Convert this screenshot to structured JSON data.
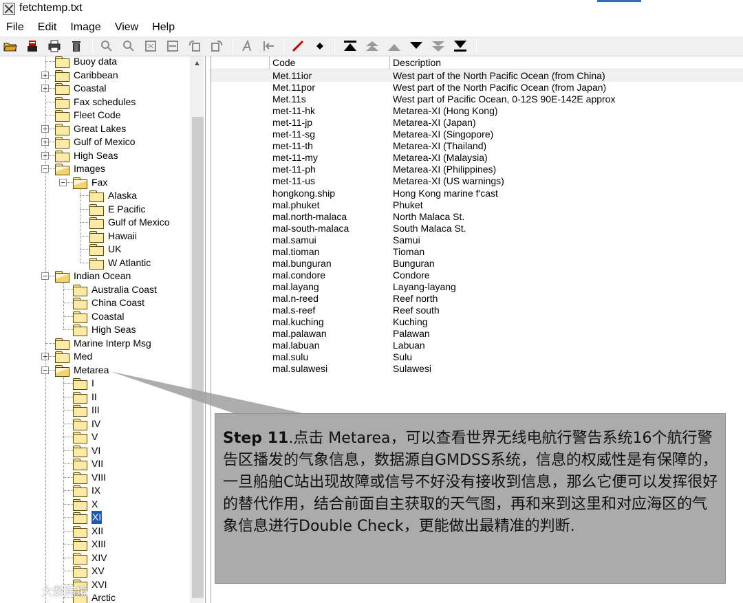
{
  "window": {
    "title": "fetchtemp.txt"
  },
  "menu": [
    "File",
    "Edit",
    "Image",
    "View",
    "Help"
  ],
  "toolbar": {
    "icons": [
      "open-folder-icon",
      "save-icon",
      "print-icon",
      "delete-icon",
      "zoom-in-icon",
      "zoom-out-icon",
      "fit-icon",
      "fit-width-icon",
      "rotate-left-icon",
      "rotate-right-icon",
      "text-icon",
      "back-icon",
      "line-icon",
      "point-icon",
      "top-icon",
      "up-fast-icon",
      "up-icon",
      "down-icon",
      "down-fast-icon",
      "bottom-icon"
    ],
    "colors": {
      "red": "#c00000",
      "black": "#000000",
      "gray": "#8a8a8a"
    }
  },
  "tree": {
    "items": [
      {
        "label": "Buoy data",
        "level": 1,
        "expander": "",
        "open": false
      },
      {
        "label": "Caribbean",
        "level": 1,
        "expander": "+",
        "open": false
      },
      {
        "label": "Coastal",
        "level": 1,
        "expander": "+",
        "open": false
      },
      {
        "label": "Fax schedules",
        "level": 1,
        "expander": "",
        "open": false
      },
      {
        "label": "Fleet Code",
        "level": 1,
        "expander": "",
        "open": false
      },
      {
        "label": "Great Lakes",
        "level": 1,
        "expander": "+",
        "open": false
      },
      {
        "label": "Gulf of Mexico",
        "level": 1,
        "expander": "+",
        "open": false
      },
      {
        "label": "High Seas",
        "level": 1,
        "expander": "+",
        "open": false
      },
      {
        "label": "Images",
        "level": 1,
        "expander": "-",
        "open": true
      },
      {
        "label": "Fax",
        "level": 2,
        "expander": "-",
        "open": true
      },
      {
        "label": "Alaska",
        "level": 3,
        "expander": "",
        "open": false
      },
      {
        "label": "E Pacific",
        "level": 3,
        "expander": "",
        "open": false
      },
      {
        "label": "Gulf of Mexico",
        "level": 3,
        "expander": "",
        "open": false
      },
      {
        "label": "Hawaii",
        "level": 3,
        "expander": "",
        "open": false
      },
      {
        "label": "UK",
        "level": 3,
        "expander": "",
        "open": false
      },
      {
        "label": "W Atlantic",
        "level": 3,
        "expander": "",
        "open": false
      },
      {
        "label": "Indian Ocean",
        "level": 1,
        "expander": "-",
        "open": true
      },
      {
        "label": "Australia Coast",
        "level": 2,
        "expander": "",
        "open": false
      },
      {
        "label": "China Coast",
        "level": 2,
        "expander": "",
        "open": false
      },
      {
        "label": "Coastal",
        "level": 2,
        "expander": "",
        "open": false
      },
      {
        "label": "High Seas",
        "level": 2,
        "expander": "",
        "open": false
      },
      {
        "label": "Marine Interp Msg",
        "level": 1,
        "expander": "",
        "open": false
      },
      {
        "label": "Med",
        "level": 1,
        "expander": "+",
        "open": false
      },
      {
        "label": "Metarea",
        "level": 1,
        "expander": "-",
        "open": true
      },
      {
        "label": "I",
        "level": 2,
        "expander": "",
        "open": false
      },
      {
        "label": "II",
        "level": 2,
        "expander": "",
        "open": false
      },
      {
        "label": "III",
        "level": 2,
        "expander": "",
        "open": false
      },
      {
        "label": "IV",
        "level": 2,
        "expander": "",
        "open": false
      },
      {
        "label": "V",
        "level": 2,
        "expander": "",
        "open": false
      },
      {
        "label": "VI",
        "level": 2,
        "expander": "",
        "open": false
      },
      {
        "label": "VII",
        "level": 2,
        "expander": "",
        "open": false
      },
      {
        "label": "VIII",
        "level": 2,
        "expander": "",
        "open": false
      },
      {
        "label": "IX",
        "level": 2,
        "expander": "",
        "open": false
      },
      {
        "label": "X",
        "level": 2,
        "expander": "",
        "open": false
      },
      {
        "label": "XI",
        "level": 2,
        "expander": "",
        "open": false,
        "selected": true
      },
      {
        "label": "XII",
        "level": 2,
        "expander": "",
        "open": false
      },
      {
        "label": "XIII",
        "level": 2,
        "expander": "",
        "open": false
      },
      {
        "label": "XIV",
        "level": 2,
        "expander": "",
        "open": false
      },
      {
        "label": "XV",
        "level": 2,
        "expander": "",
        "open": false
      },
      {
        "label": "XVI",
        "level": 2,
        "expander": "",
        "open": false
      },
      {
        "label": "Arctic",
        "level": 2,
        "expander": "",
        "open": false
      }
    ]
  },
  "list": {
    "columns": [
      "Code",
      "Description"
    ],
    "rows": [
      [
        "Met.11ior",
        "West part of the North Pacific Ocean (from China)"
      ],
      [
        "Met.11por",
        "West part of the North Pacific Ocean (from Japan)"
      ],
      [
        "Met.11s",
        "West part of Pacific Ocean, 0-12S 90E-142E approx"
      ],
      [
        "met-11-hk",
        "Metarea-XI (Hong Kong)"
      ],
      [
        "met-11-jp",
        "Metarea-XI (Japan)"
      ],
      [
        "met-11-sg",
        "Metarea-XI (Singopore)"
      ],
      [
        "met-11-th",
        "Metarea-XI (Thailand)"
      ],
      [
        "met-11-my",
        "Metarea-XI (Malaysia)"
      ],
      [
        "met-11-ph",
        "Metarea-XI (Philippines)"
      ],
      [
        "met-11-us",
        "Metarea-XI (US warnings)"
      ],
      [
        "hongkong.ship",
        "Hong Kong marine f'cast"
      ],
      [
        "mal.phuket",
        "Phuket"
      ],
      [
        "mal.north-malaca",
        "North Malaca St."
      ],
      [
        "mal-south-malaca",
        "South Malaca St."
      ],
      [
        "mal.samui",
        "Samui"
      ],
      [
        "mal.tioman",
        "Tioman"
      ],
      [
        "mal.bunguran",
        "Bunguran"
      ],
      [
        "mal.condore",
        "Condore"
      ],
      [
        "mal.layang",
        "Layang-layang"
      ],
      [
        "mal.n-reed",
        "Reef north"
      ],
      [
        "mal.s-reef",
        "Reef south"
      ],
      [
        "mal.kuching",
        "Kuching"
      ],
      [
        "mal.palawan",
        "Palawan"
      ],
      [
        "mal.labuan",
        "Labuan"
      ],
      [
        "mal.sulu",
        "Sulu"
      ],
      [
        "mal.sulawesi",
        "Sulawesi"
      ]
    ]
  },
  "callout": {
    "step": "Step 11",
    "text": ".点击 Metarea，可以查看世界无线电航行警告系统16个航行警告区播发的气象信息，数据源自GMDSS系统，信息的权威性是有保障的，一旦船舶C站出现故障或信号不好没有接收到信息，那么它便可以发挥很好的替代作用，结合前面自主获取的天气图，再和来到这里和对应海区的气象信息进行Double Check，更能做出最精准的判断."
  },
  "watermark": {
    "text": "大数跨境"
  }
}
